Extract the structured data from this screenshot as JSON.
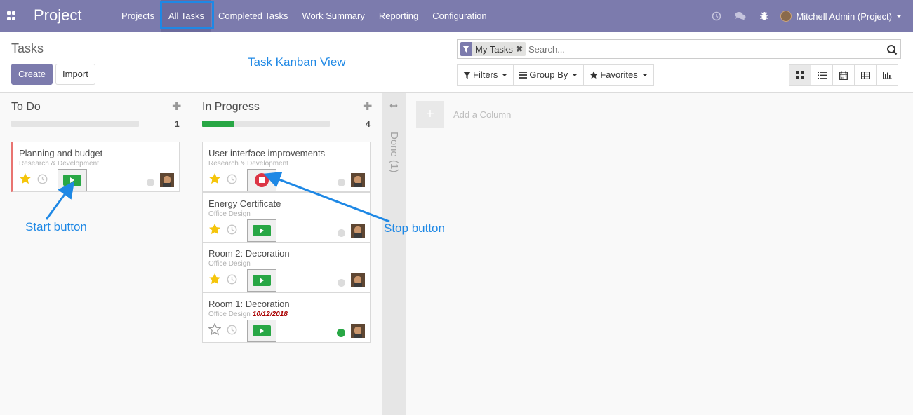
{
  "navbar": {
    "app_title": "Project",
    "menu": [
      "Projects",
      "All Tasks",
      "Completed Tasks",
      "Work Summary",
      "Reporting",
      "Configuration"
    ],
    "user": "Mitchell Admin (Project)",
    "bg_color": "#7c7bad"
  },
  "control_panel": {
    "breadcrumb": "Tasks",
    "create_label": "Create",
    "import_label": "Import",
    "annotation": "Task Kanban View",
    "facet_label": "My Tasks",
    "search_placeholder": "Search...",
    "filters_label": "Filters",
    "groupby_label": "Group By",
    "favorites_label": "Favorites",
    "views": [
      "kanban-icon",
      "list-icon",
      "calendar-icon",
      "pivot-icon",
      "graph-icon"
    ]
  },
  "kanban": {
    "columns": [
      {
        "title": "To Do",
        "count": "1",
        "progress_fraction": 0.0,
        "cards": [
          {
            "title": "Planning and budget",
            "project": "Research & Development",
            "date": "",
            "starred": true,
            "timer": "start",
            "state": "grey"
          }
        ]
      },
      {
        "title": "In Progress",
        "count": "4",
        "progress_fraction": 0.25,
        "cards": [
          {
            "title": "User interface improvements",
            "project": "Research & Development",
            "date": "",
            "starred": true,
            "timer": "stop",
            "state": "grey"
          },
          {
            "title": "Energy Certificate",
            "project": "Office Design",
            "date": "",
            "starred": true,
            "timer": "start",
            "state": "grey"
          },
          {
            "title": "Room 2: Decoration",
            "project": "Office Design",
            "date": "",
            "starred": true,
            "timer": "start",
            "state": "grey"
          },
          {
            "title": "Room 1: Decoration",
            "project": "Office Design",
            "date": "10/12/2018",
            "starred": false,
            "timer": "start",
            "state": "green"
          }
        ]
      }
    ],
    "folded_column": "Done (1)",
    "add_column_label": "Add a Column"
  },
  "annotations": {
    "start_button": "Start button",
    "stop_button": "Stop button"
  }
}
